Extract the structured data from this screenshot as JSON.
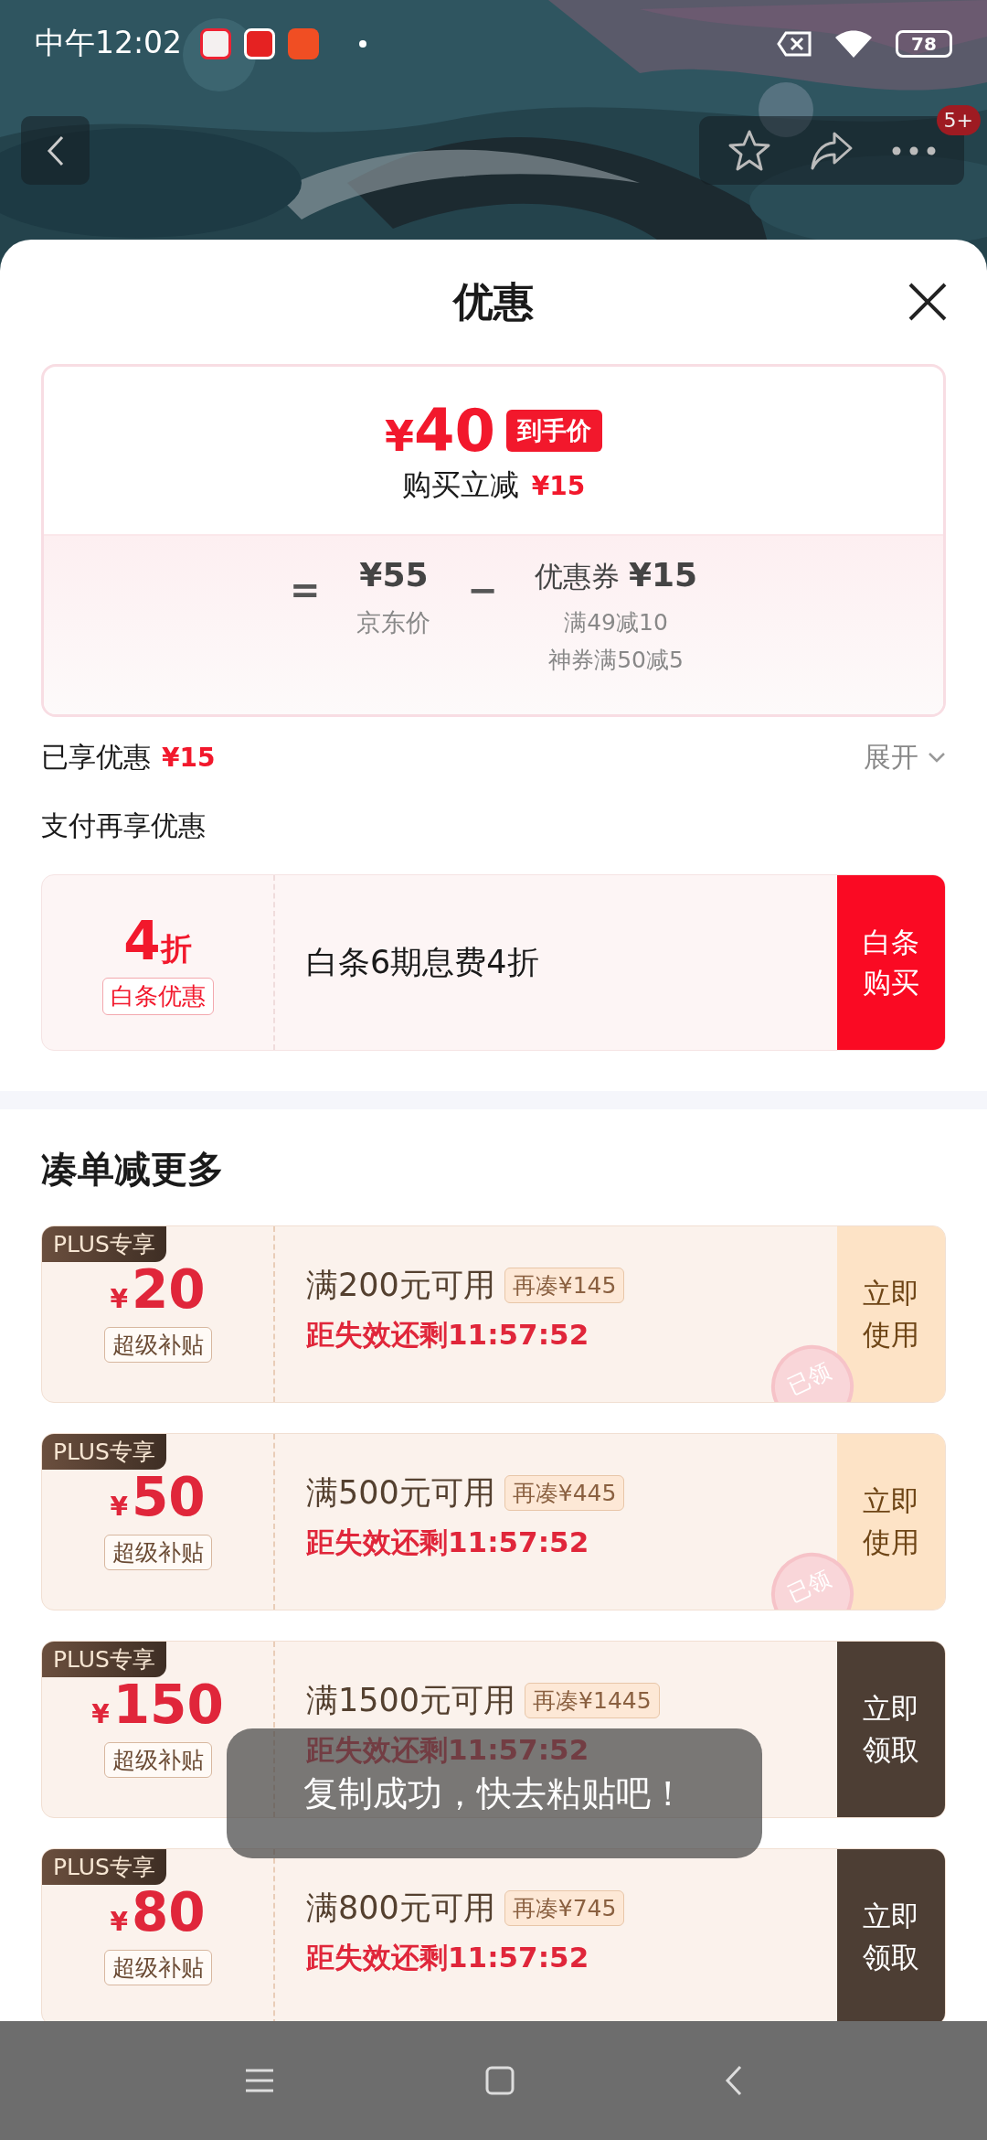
{
  "status_bar": {
    "time": "中午12:02",
    "battery": "78"
  },
  "top_bar": {
    "badge": "5+"
  },
  "sheet": {
    "title": "优惠"
  },
  "price_card": {
    "currency": "¥",
    "final_price": "40",
    "final_tag": "到手价",
    "instant_label": "购买立减",
    "instant_amount": "¥15",
    "equals": "=",
    "jd_price": "¥55",
    "jd_label": "京东价",
    "minus": "−",
    "coupon_label": "优惠券",
    "coupon_amount": "¥15",
    "coupon_details": [
      "满49减10",
      "神券满50减5"
    ]
  },
  "enjoyed": {
    "label": "已享优惠",
    "amount": "¥15",
    "expand": "展开"
  },
  "pay_section": {
    "title": "支付再享优惠"
  },
  "baitiao": {
    "discount_number": "4",
    "discount_unit": "折",
    "tag": "白条优惠",
    "description": "白条6期息费4折",
    "button": "白条购买"
  },
  "more_section": {
    "title": "凑单减更多"
  },
  "coupons": [
    {
      "kind": "use",
      "badge": "PLUS专享",
      "currency": "¥",
      "amount": "20",
      "tag": "超级补贴",
      "condition": "满200元可用",
      "addon": "再凑¥145",
      "countdown": "距失效还剩11:57:52",
      "button": "立即使用",
      "stamp": "已领"
    },
    {
      "kind": "use",
      "badge": "PLUS专享",
      "currency": "¥",
      "amount": "50",
      "tag": "超级补贴",
      "condition": "满500元可用",
      "addon": "再凑¥445",
      "countdown": "距失效还剩11:57:52",
      "button": "立即使用",
      "stamp": "已领"
    },
    {
      "kind": "claim",
      "badge": "PLUS专享",
      "currency": "¥",
      "amount": "150",
      "tag": "超级补贴",
      "condition": "满1500元可用",
      "addon": "再凑¥1445",
      "countdown": "距失效还剩11:57:52",
      "button": "立即领取"
    },
    {
      "kind": "claim",
      "badge": "PLUS专享",
      "currency": "¥",
      "amount": "80",
      "tag": "超级补贴",
      "condition": "满800元可用",
      "addon": "再凑¥745",
      "countdown": "距失效还剩11:57:52",
      "button": "立即领取"
    }
  ],
  "toast": {
    "text": "复制成功，快去粘贴吧！"
  }
}
